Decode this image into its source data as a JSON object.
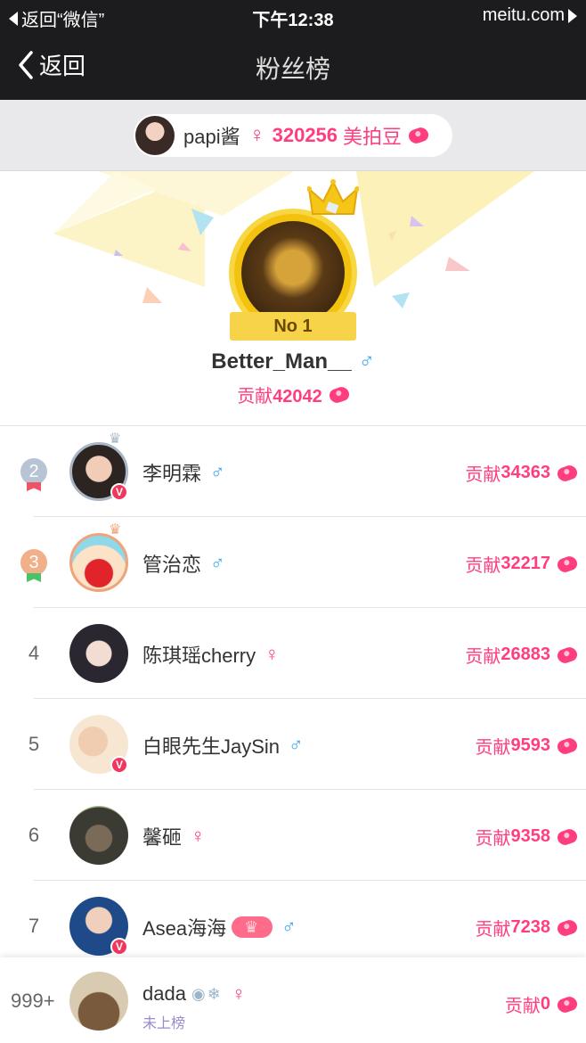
{
  "status_bar": {
    "back_app": "返回“微信”",
    "time": "下午12:38",
    "carrier": "meitu.com"
  },
  "nav": {
    "back_label": "返回",
    "title": "粉丝榜"
  },
  "host": {
    "name": "papi酱",
    "gender": "♀",
    "beans": "320256",
    "unit": "美拍豆"
  },
  "top": {
    "rank_label": "No 1",
    "name": "Better_Man__",
    "gender": "♂",
    "contrib_label": "贡献",
    "contrib_value": "42042"
  },
  "list": [
    {
      "rank": "2",
      "name": "李明霖",
      "gender": "♂",
      "contrib_label": "贡献",
      "contrib_value": "34363"
    },
    {
      "rank": "3",
      "name": "管治恋",
      "gender": "♂",
      "contrib_label": "贡献",
      "contrib_value": "32217"
    },
    {
      "rank": "4",
      "name": "陈琪瑶cherry",
      "gender": "♀",
      "contrib_label": "贡献",
      "contrib_value": "26883"
    },
    {
      "rank": "5",
      "name": "白眼先生JaySin",
      "gender": "♂",
      "contrib_label": "贡献",
      "contrib_value": "9593"
    },
    {
      "rank": "6",
      "name": "馨砸",
      "gender": "♀",
      "contrib_label": "贡献",
      "contrib_value": "9358"
    },
    {
      "rank": "7",
      "name": "Asea海海",
      "gender": "♂",
      "contrib_label": "贡献",
      "contrib_value": "7238"
    }
  ],
  "me": {
    "rank": "999+",
    "name": "dada",
    "gender": "♀",
    "status": "未上榜",
    "contrib_label": "贡献",
    "contrib_value": "0"
  },
  "colors": {
    "accent_pink": "#ff3e7f",
    "male_blue": "#3aa3f0",
    "nav_bg": "#1c1c1e",
    "gold": "#f3c20f"
  }
}
